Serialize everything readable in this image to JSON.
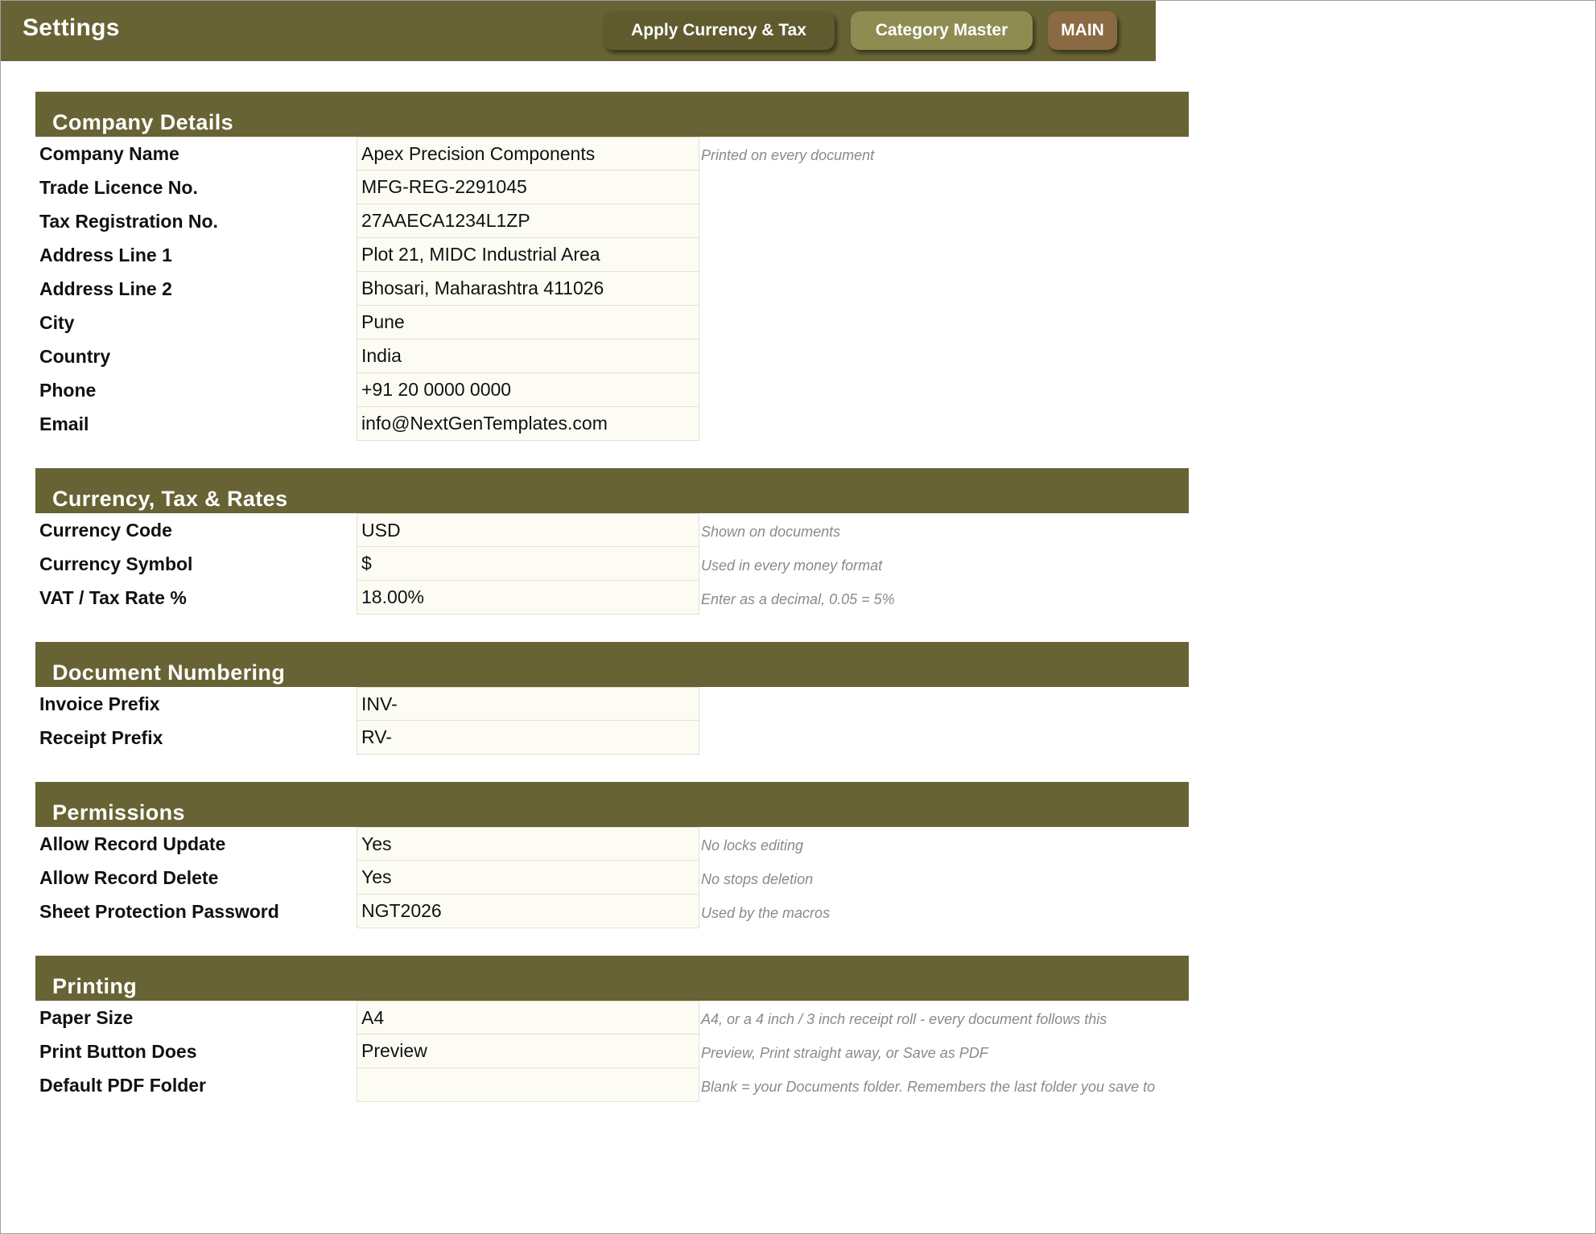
{
  "header": {
    "title": "Settings",
    "buttons": {
      "apply": "Apply Currency & Tax",
      "category": "Category Master",
      "main": "MAIN"
    }
  },
  "sections": [
    {
      "title": "Company Details",
      "rows": [
        {
          "label": "Company Name",
          "value": "Apex Precision Components",
          "note": "Printed on every document"
        },
        {
          "label": "Trade Licence No.",
          "value": "MFG-REG-2291045",
          "note": ""
        },
        {
          "label": "Tax Registration No.",
          "value": "27AAECA1234L1ZP",
          "note": ""
        },
        {
          "label": "Address Line 1",
          "value": "Plot 21, MIDC Industrial Area",
          "note": ""
        },
        {
          "label": "Address Line 2",
          "value": "Bhosari, Maharashtra 411026",
          "note": ""
        },
        {
          "label": "City",
          "value": "Pune",
          "note": ""
        },
        {
          "label": "Country",
          "value": "India",
          "note": ""
        },
        {
          "label": "Phone",
          "value": "+91 20 0000 0000",
          "note": ""
        },
        {
          "label": "Email",
          "value": "info@NextGenTemplates.com",
          "note": ""
        }
      ]
    },
    {
      "title": "Currency, Tax & Rates",
      "rows": [
        {
          "label": "Currency Code",
          "value": "USD",
          "note": "Shown on documents"
        },
        {
          "label": "Currency Symbol",
          "value": "$",
          "note": "Used in every money format"
        },
        {
          "label": "VAT / Tax Rate %",
          "value": "18.00%",
          "note": "Enter as a decimal, 0.05 = 5%"
        }
      ]
    },
    {
      "title": "Document Numbering",
      "rows": [
        {
          "label": "Invoice Prefix",
          "value": "INV-",
          "note": ""
        },
        {
          "label": "Receipt Prefix",
          "value": "RV-",
          "note": ""
        }
      ]
    },
    {
      "title": "Permissions",
      "rows": [
        {
          "label": "Allow Record Update",
          "value": "Yes",
          "note": "No locks editing"
        },
        {
          "label": "Allow Record Delete",
          "value": "Yes",
          "note": "No stops deletion"
        },
        {
          "label": "Sheet Protection Password",
          "value": "NGT2026",
          "note": "Used by the macros"
        }
      ]
    },
    {
      "title": "Printing",
      "rows": [
        {
          "label": "Paper Size",
          "value": "A4",
          "note": "A4, or a 4 inch / 3 inch receipt roll - every document follows this"
        },
        {
          "label": "Print Button Does",
          "value": "Preview",
          "note": "Preview, Print straight away, or Save as PDF"
        },
        {
          "label": "Default PDF Folder",
          "value": "",
          "note": "Blank = your Documents folder. Remembers the last folder you save to"
        }
      ]
    }
  ]
}
